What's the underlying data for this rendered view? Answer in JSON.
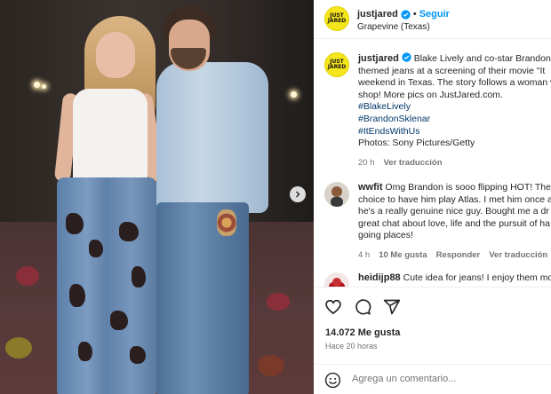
{
  "post": {
    "account": "justjared",
    "avatar_text_1": "JUST",
    "avatar_text_2": "JARED",
    "follow_separator": "•",
    "follow_label": "Seguir",
    "location": "Grapevine (Texas)"
  },
  "caption": {
    "username": "justjared",
    "lines": [
      "Blake Lively and co-star Brandon S",
      "themed jeans at a screening of their movie \"It",
      "weekend in Texas. The story follows a woman w",
      "shop! More pics on JustJared.com."
    ],
    "hashtags": [
      "#BlakeLively",
      "#BrandonSklenar",
      "#ItEndsWithUs"
    ],
    "credit": "Photos: Sony Pictures/Getty",
    "age": "20 h",
    "translate": "Ver traducción"
  },
  "comments": [
    {
      "username": "wwfit",
      "lines": [
        "Omg Brandon is sooo flipping HOT! The",
        "choice to have him play Atlas. I met him once a",
        "he's a really genuine nice guy. Bought me a dr",
        "great chat about love, life and the pursuit of ha",
        "going places!"
      ],
      "age": "4 h",
      "likes": "10 Me gusta",
      "reply": "Responder",
      "translate": "Ver traducción"
    },
    {
      "username": "heidijp88",
      "lines": [
        "Cute idea for jeans! I enjoy them mo"
      ]
    }
  ],
  "actions": {
    "likes": "14.072 Me gusta",
    "time": "Hace 20 horas",
    "comment_placeholder": "Agrega un comentario..."
  },
  "colors": {
    "accent": "#0095f6",
    "hashtag": "#00376b",
    "brand_yellow": "#f5e51c",
    "muted": "#737373"
  },
  "icons": [
    "verified-badge-icon",
    "chevron-right-icon",
    "heart-icon",
    "comment-icon",
    "share-icon",
    "emoji-icon"
  ]
}
